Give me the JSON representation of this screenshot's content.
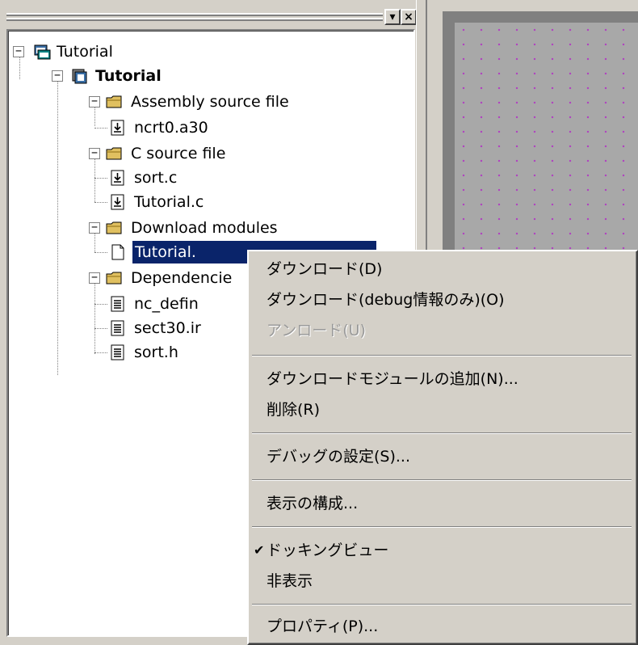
{
  "tree": {
    "nodes": [
      {
        "label": "Tutorial",
        "icon": "workspace-icon",
        "expander": "−"
      },
      {
        "label": "Tutorial",
        "icon": "project-icon",
        "expander": "−"
      },
      {
        "label": "Assembly source file",
        "icon": "folder-icon",
        "expander": "−"
      },
      {
        "label": "ncrt0.a30",
        "icon": "source-file-icon"
      },
      {
        "label": "C source file",
        "icon": "folder-icon",
        "expander": "−"
      },
      {
        "label": "sort.c",
        "icon": "source-file-icon"
      },
      {
        "label": "Tutorial.c",
        "icon": "source-file-icon"
      },
      {
        "label": "Download modules",
        "icon": "folder-icon",
        "expander": "−"
      },
      {
        "label": "Tutorial.",
        "icon": "blank-file-icon"
      },
      {
        "label": "Dependencie",
        "icon": "folder-icon",
        "expander": "−"
      },
      {
        "label": "nc_defin",
        "icon": "header-file-icon"
      },
      {
        "label": "sect30.ir",
        "icon": "header-file-icon"
      },
      {
        "label": "sort.h",
        "icon": "header-file-icon"
      }
    ]
  },
  "pane_buttons": {
    "dropdown": "▾",
    "close": "×"
  },
  "context_menu": {
    "items": [
      {
        "label": "ダウンロード(D)"
      },
      {
        "label": "ダウンロード(debug情報のみ)(O)"
      },
      {
        "label": "アンロード(U)",
        "disabled": true
      },
      {
        "label": "ダウンロードモジュールの追加(N)..."
      },
      {
        "label": "削除(R)"
      },
      {
        "label": "デバッグの設定(S)..."
      },
      {
        "label": "表示の構成..."
      },
      {
        "label": "ドッキングビュー",
        "checked": true,
        "check_glyph": "✔"
      },
      {
        "label": "非表示"
      },
      {
        "label": "プロパティ(P)..."
      }
    ]
  },
  "colors": {
    "selection": "#0a246a",
    "window_bg": "#d4d0c8",
    "dots": "#b040c0"
  }
}
